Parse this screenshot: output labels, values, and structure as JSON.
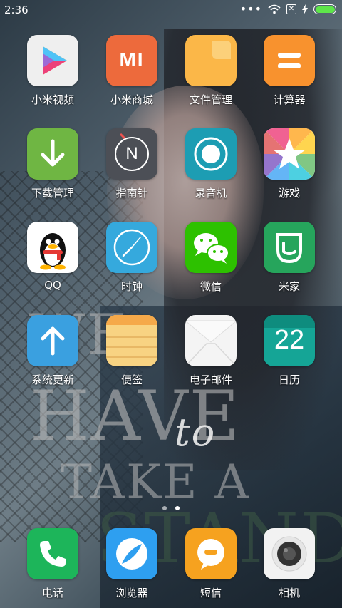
{
  "status_bar": {
    "time": "2:36",
    "dots": "•••"
  },
  "apps": [
    {
      "label": "小米视频",
      "icon": "video-play-icon",
      "bg": "#efefef"
    },
    {
      "label": "小米商城",
      "icon": "mi-logo-icon",
      "bg": "#ed6a3c",
      "text": "MI"
    },
    {
      "label": "文件管理",
      "icon": "folder-icon",
      "bg": "#fbb748"
    },
    {
      "label": "计算器",
      "icon": "equals-icon",
      "bg": "#f8922e"
    },
    {
      "label": "下载管理",
      "icon": "download-arrow-icon",
      "bg": "#6fb643"
    },
    {
      "label": "指南针",
      "icon": "compass-icon",
      "bg": "#4c4f56",
      "text": "N"
    },
    {
      "label": "录音机",
      "icon": "record-icon",
      "bg": "#1d9db3"
    },
    {
      "label": "游戏",
      "icon": "star-icon",
      "bg": "#ffffff"
    },
    {
      "label": "QQ",
      "icon": "penguin-icon",
      "bg": "#ffffff"
    },
    {
      "label": "时钟",
      "icon": "clock-icon",
      "bg": "#35a9dd"
    },
    {
      "label": "微信",
      "icon": "wechat-icon",
      "bg": "#2dc100"
    },
    {
      "label": "米家",
      "icon": "mijia-icon",
      "bg": "#26a55c"
    },
    {
      "label": "系统更新",
      "icon": "up-arrow-icon",
      "bg": "#3aa0e0"
    },
    {
      "label": "便签",
      "icon": "notes-icon",
      "bg": "#f8d382"
    },
    {
      "label": "电子邮件",
      "icon": "envelope-icon",
      "bg": "#f4f4f4"
    },
    {
      "label": "日历",
      "icon": "calendar-icon",
      "bg": "#15a596",
      "text": "22"
    }
  ],
  "dock": [
    {
      "label": "电话",
      "icon": "phone-icon",
      "bg": "#1db55a"
    },
    {
      "label": "浏览器",
      "icon": "browser-icon",
      "bg": "#2e9ff0"
    },
    {
      "label": "短信",
      "icon": "message-icon",
      "bg": "#f6a21f"
    },
    {
      "label": "相机",
      "icon": "camera-icon",
      "bg": "#f2f2f2"
    }
  ],
  "wallpaper_text": {
    "we": "WE",
    "have": "HAVE",
    "to": "to",
    "take": "TAKE A",
    "stand": "STAND"
  }
}
